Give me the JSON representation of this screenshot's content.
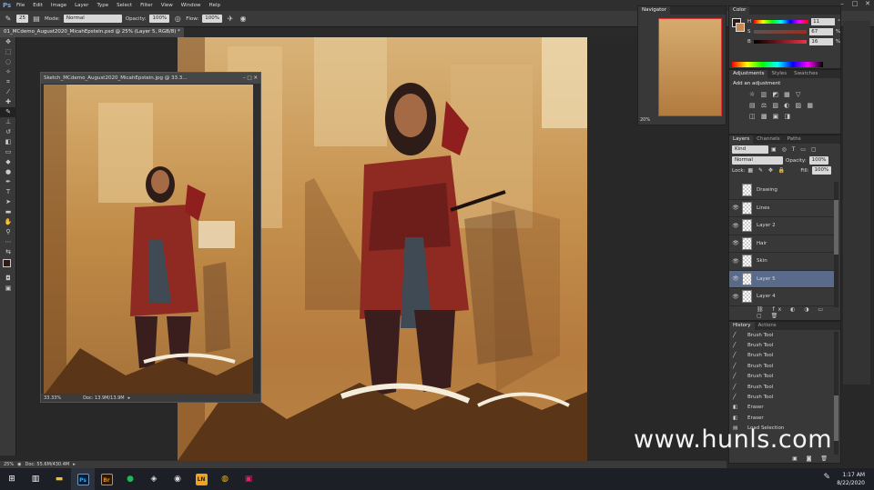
{
  "menu": {
    "logo": "Ps",
    "items": [
      "File",
      "Edit",
      "Image",
      "Layer",
      "Type",
      "Select",
      "Filter",
      "View",
      "Window",
      "Help"
    ]
  },
  "options": {
    "brush_size": "25",
    "mode_label": "Mode:",
    "mode_value": "Normal",
    "opacity_label": "Opacity:",
    "opacity_value": "100%",
    "flow_label": "Flow:",
    "flow_value": "100%"
  },
  "document": {
    "tab_title": "01_MCdemo_August2020_MicahEpstein.psd @ 25% (Layer 5, RGB/8) *",
    "zoom": "25%",
    "doc_size": "Doc: 55.6M/430.4M"
  },
  "sketch_window": {
    "title": "Sketch_MCdemo_August2020_MicahEpstein.jpg @ 33.3...",
    "zoom": "33.33%",
    "doc_size": "Doc: 13.9M/13.9M"
  },
  "navigator": {
    "tab": "Navigator",
    "zoom": "20%"
  },
  "color": {
    "tab": "Color",
    "rows": [
      {
        "label": "H",
        "value": "11",
        "unit": "°"
      },
      {
        "label": "S",
        "value": "67",
        "unit": "%"
      },
      {
        "label": "B",
        "value": "16",
        "unit": "%"
      }
    ]
  },
  "adjustments": {
    "tabs": [
      "Adjustments",
      "Styles",
      "Swatches"
    ],
    "heading": "Add an adjustment"
  },
  "layers": {
    "tabs": [
      "Layers",
      "Channels",
      "Paths"
    ],
    "kind": "Kind",
    "blend": "Normal",
    "opacity_label": "Opacity:",
    "opacity_value": "100%",
    "lock_label": "Lock:",
    "fill_label": "Fill:",
    "fill_value": "100%",
    "items": [
      {
        "name": "Drawing"
      },
      {
        "name": "Lines"
      },
      {
        "name": "Layer 2"
      },
      {
        "name": "Hair"
      },
      {
        "name": "Skin"
      },
      {
        "name": "Layer 5"
      },
      {
        "name": "Layer 4"
      }
    ]
  },
  "history": {
    "tabs": [
      "History",
      "Actions"
    ],
    "items": [
      "Brush Tool",
      "Brush Tool",
      "Brush Tool",
      "Brush Tool",
      "Brush Tool",
      "Brush Tool",
      "Brush Tool",
      "Eraser",
      "Eraser",
      "Load Selection"
    ]
  },
  "taskbar": {
    "time": "1:17 AM",
    "date": "8/22/2020",
    "apps": [
      "Ps",
      "Br",
      "LN"
    ]
  },
  "watermark": "www.hunls.com",
  "colors": {
    "accent": "#5a6a8a",
    "ps_blue": "#31a8ff",
    "bridge": "#e48b1c"
  }
}
